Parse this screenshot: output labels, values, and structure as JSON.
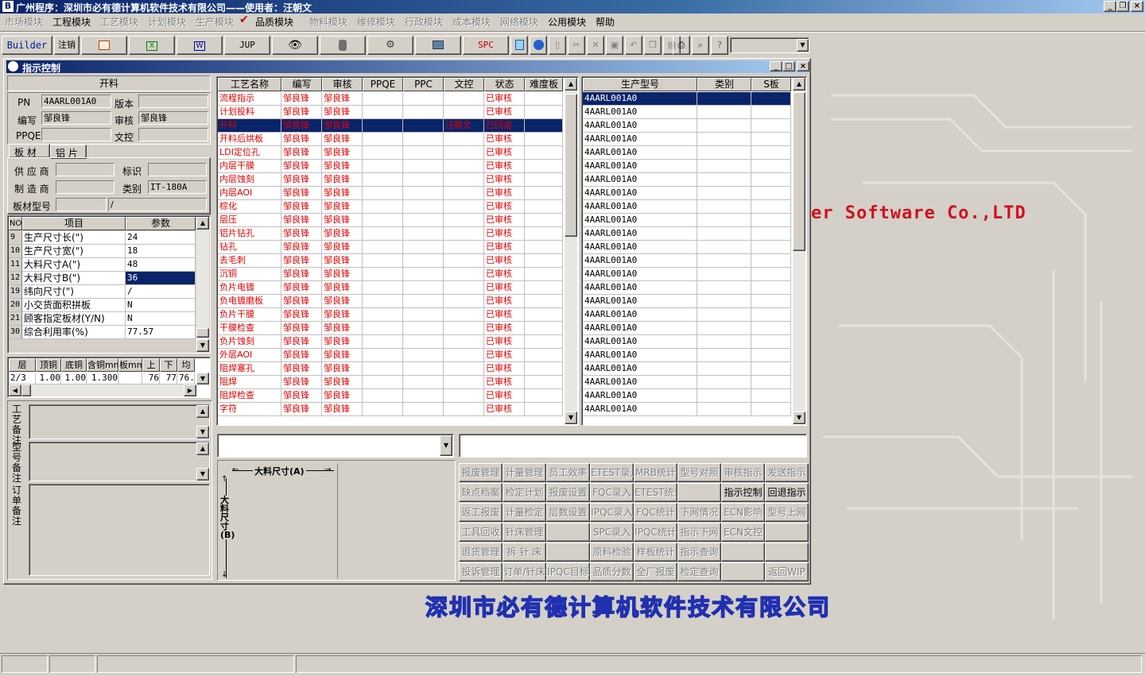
{
  "app": {
    "title": "广州程序：深圳市必有德计算机软件技术有限公司——使用者：汪朝文"
  },
  "menu": {
    "items": [
      {
        "label": "市场模块",
        "enabled": false
      },
      {
        "label": "工程模块",
        "enabled": true
      },
      {
        "label": "工艺模块",
        "enabled": false
      },
      {
        "label": "计划模块",
        "enabled": false
      },
      {
        "label": "生产模块",
        "enabled": false
      },
      {
        "label": "品质模块",
        "enabled": true
      },
      {
        "label": "物料模块",
        "enabled": false
      },
      {
        "label": "维修模块",
        "enabled": false
      },
      {
        "label": "行政模块",
        "enabled": false
      },
      {
        "label": "成本模块",
        "enabled": false
      },
      {
        "label": "网络模块",
        "enabled": false
      },
      {
        "label": "公用模块",
        "enabled": true
      },
      {
        "label": "帮助",
        "enabled": true
      }
    ]
  },
  "toolbar": {
    "builder": "Builder",
    "logout": "注销",
    "jup": "JUP",
    "spc": "SPC"
  },
  "desktop": {
    "logo_text": "er Software Co.,LTD",
    "company_banner": "深圳市必有德计算机软件技术有限公司"
  },
  "window": {
    "title": "指示控制"
  },
  "left_panel": {
    "process_title": "开料",
    "pn_label": "PN",
    "pn_value": "4AARL001A0",
    "version_label": "版本",
    "version_value": "",
    "editor_label": "编写",
    "editor_value": "邹良锋",
    "reviewer_label": "审核",
    "reviewer_value": "邹良锋",
    "ppqe_label": "PPQE",
    "ppqe_value": "",
    "docctl_label": "文控",
    "docctl_value": "",
    "tabs": [
      "板 材",
      "铝 片"
    ],
    "supplier_label": "供 应 商",
    "supplier_value": "",
    "mark_label": "标识",
    "mark_value": "",
    "maker_label": "制 造 商",
    "maker_value": "",
    "category_label": "类别",
    "category_value": "IT-180A",
    "board_model_label": "板材型号",
    "board_model_value": "",
    "board_model_value2": "/",
    "params_headers": [
      "NO",
      "项目",
      "参数"
    ],
    "params": [
      {
        "no": "9",
        "item": "生产尺寸长(\")",
        "value": "24"
      },
      {
        "no": "10",
        "item": "生产尺寸宽(\")",
        "value": "18"
      },
      {
        "no": "11",
        "item": "大料尺寸A(\")",
        "value": "48"
      },
      {
        "no": "12",
        "item": "大料尺寸B(\")",
        "value": "36"
      },
      {
        "no": "19",
        "item": "纬向尺寸(\")",
        "value": "/"
      },
      {
        "no": "20",
        "item": "小交货面积拼板",
        "value": "N"
      },
      {
        "no": "21",
        "item": "顾客指定板材(Y/N)",
        "value": "N"
      },
      {
        "no": "30",
        "item": "综合利用率(%)",
        "value": "77.57"
      }
    ],
    "layer_headers": [
      "层",
      "顶铜",
      "底铜",
      "含铜mm",
      "板mm",
      "上",
      "下",
      "均"
    ],
    "layer_row": [
      "2/3",
      "1.00",
      "1.00",
      "1.300",
      "",
      "76",
      "77",
      "76."
    ],
    "remark_labels": [
      "工艺备注",
      "型号备注",
      "订单备注"
    ]
  },
  "process_table": {
    "headers": [
      "工艺名称",
      "编写",
      "审核",
      "PPQE",
      "PPC",
      "文控",
      "状态",
      "难度板"
    ],
    "rows": [
      {
        "name": "流程指示",
        "editor": "邹良锋",
        "reviewer": "邹良锋",
        "ppqe": "",
        "ppc": "",
        "docctl": "",
        "status": "已审核"
      },
      {
        "name": "计划投料",
        "editor": "邹良锋",
        "reviewer": "邹良锋",
        "ppqe": "",
        "ppc": "",
        "docctl": "",
        "status": "已审核"
      },
      {
        "name": "开料",
        "editor": "邹良锋",
        "reviewer": "邹良锋",
        "ppqe": "",
        "ppc": "",
        "docctl": "汪朝文",
        "status": "已回退",
        "selected": true
      },
      {
        "name": "开料后烘板",
        "editor": "邹良锋",
        "reviewer": "邹良锋",
        "ppqe": "",
        "ppc": "",
        "docctl": "",
        "status": "已审核"
      },
      {
        "name": "LDI定位孔",
        "editor": "邹良锋",
        "reviewer": "邹良锋",
        "ppqe": "",
        "ppc": "",
        "docctl": "",
        "status": "已审核"
      },
      {
        "name": "内层干膜",
        "editor": "邹良锋",
        "reviewer": "邹良锋",
        "ppqe": "",
        "ppc": "",
        "docctl": "",
        "status": "已审核"
      },
      {
        "name": "内层蚀刻",
        "editor": "邹良锋",
        "reviewer": "邹良锋",
        "ppqe": "",
        "ppc": "",
        "docctl": "",
        "status": "已审核"
      },
      {
        "name": "内层AOI",
        "editor": "邹良锋",
        "reviewer": "邹良锋",
        "ppqe": "",
        "ppc": "",
        "docctl": "",
        "status": "已审核"
      },
      {
        "name": "棕化",
        "editor": "邹良锋",
        "reviewer": "邹良锋",
        "ppqe": "",
        "ppc": "",
        "docctl": "",
        "status": "已审核"
      },
      {
        "name": "层压",
        "editor": "邹良锋",
        "reviewer": "邹良锋",
        "ppqe": "",
        "ppc": "",
        "docctl": "",
        "status": "已审核"
      },
      {
        "name": "铝片钻孔",
        "editor": "邹良锋",
        "reviewer": "邹良锋",
        "ppqe": "",
        "ppc": "",
        "docctl": "",
        "status": "已审核"
      },
      {
        "name": "钻孔",
        "editor": "邹良锋",
        "reviewer": "邹良锋",
        "ppqe": "",
        "ppc": "",
        "docctl": "",
        "status": "已审核"
      },
      {
        "name": "去毛刺",
        "editor": "邹良锋",
        "reviewer": "邹良锋",
        "ppqe": "",
        "ppc": "",
        "docctl": "",
        "status": "已审核"
      },
      {
        "name": "沉铜",
        "editor": "邹良锋",
        "reviewer": "邹良锋",
        "ppqe": "",
        "ppc": "",
        "docctl": "",
        "status": "已审核"
      },
      {
        "name": "负片电镀",
        "editor": "邹良锋",
        "reviewer": "邹良锋",
        "ppqe": "",
        "ppc": "",
        "docctl": "",
        "status": "已审核"
      },
      {
        "name": "负电镀磨板",
        "editor": "邹良锋",
        "reviewer": "邹良锋",
        "ppqe": "",
        "ppc": "",
        "docctl": "",
        "status": "已审核"
      },
      {
        "name": "负片干膜",
        "editor": "邹良锋",
        "reviewer": "邹良锋",
        "ppqe": "",
        "ppc": "",
        "docctl": "",
        "status": "已审核"
      },
      {
        "name": "干膜检查",
        "editor": "邹良锋",
        "reviewer": "邹良锋",
        "ppqe": "",
        "ppc": "",
        "docctl": "",
        "status": "已审核"
      },
      {
        "name": "负片蚀刻",
        "editor": "邹良锋",
        "reviewer": "邹良锋",
        "ppqe": "",
        "ppc": "",
        "docctl": "",
        "status": "已审核"
      },
      {
        "name": "外层AOI",
        "editor": "邹良锋",
        "reviewer": "邹良锋",
        "ppqe": "",
        "ppc": "",
        "docctl": "",
        "status": "已审核"
      },
      {
        "name": "阻焊塞孔",
        "editor": "邹良锋",
        "reviewer": "邹良锋",
        "ppqe": "",
        "ppc": "",
        "docctl": "",
        "status": "已审核"
      },
      {
        "name": "阻焊",
        "editor": "邹良锋",
        "reviewer": "邹良锋",
        "ppqe": "",
        "ppc": "",
        "docctl": "",
        "status": "已审核"
      },
      {
        "name": "阻焊检查",
        "editor": "邹良锋",
        "reviewer": "邹良锋",
        "ppqe": "",
        "ppc": "",
        "docctl": "",
        "status": "已审核"
      },
      {
        "name": "字符",
        "editor": "邹良锋",
        "reviewer": "邹良锋",
        "ppqe": "",
        "ppc": "",
        "docctl": "",
        "status": "已审核"
      }
    ]
  },
  "model_table": {
    "headers": [
      "生产型号",
      "类别",
      "S板"
    ],
    "rows": [
      "4AARL001A0",
      "4AARL001A0",
      "4AARL001A0",
      "4AARL001A0",
      "4AARL001A0",
      "4AARL001A0",
      "4AARL001A0",
      "4AARL001A0",
      "4AARL001A0",
      "4AARL001A0",
      "4AARL001A0",
      "4AARL001A0",
      "4AARL001A0",
      "4AARL001A0",
      "4AARL001A0",
      "4AARL001A0",
      "4AARL001A0",
      "4AARL001A0",
      "4AARL001A0",
      "4AARL001A0",
      "4AARL001A0",
      "4AARL001A0",
      "4AARL001A0",
      "4AARL001A0"
    ]
  },
  "diagram": {
    "a_label": "大料尺寸(A)",
    "b_label": "大料尺寸(B)"
  },
  "action_buttons": [
    [
      "报废管理",
      "计量管理",
      "员工效率",
      "ETEST录入",
      "MRB统计",
      "型号对照",
      "审核指示",
      "发送指示"
    ],
    [
      "缺点档案",
      "检定计划",
      "报废设置",
      "FQC录入",
      "ETEST统计",
      "",
      "指示控制",
      "回退指示"
    ],
    [
      "返工报废",
      "计量检定",
      "层数设置",
      "IPQC录入",
      "FQC统计",
      "下网情况",
      "ECN影响",
      "型号上网"
    ],
    [
      "工具回收",
      "针床管理",
      "",
      "SPC录入",
      "IPQC统计",
      "指示下网",
      "ECN文控",
      ""
    ],
    [
      "退货管理",
      "拆 针 床",
      "",
      "原料检验",
      "样板统计",
      "指示查询",
      "",
      ""
    ],
    [
      "投诉管理",
      "订单/针床",
      "IPQC目标",
      "品质分数",
      "全厂报废",
      "检定查询",
      "",
      "返回WIP"
    ]
  ],
  "enabled_buttons": [
    "指示控制",
    "回退指示"
  ],
  "colors": {
    "title_blue": "#0a246a",
    "selection": "#0a246a",
    "status_red": "#e00000",
    "logo_red": "#d01020",
    "banner_blue": "#2030b0",
    "face": "#d4d0c8"
  }
}
